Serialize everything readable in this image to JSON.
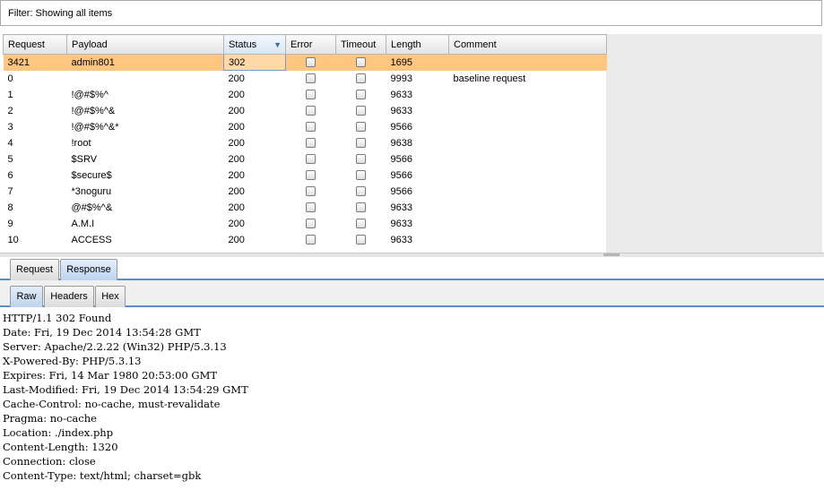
{
  "filter": {
    "text": "Filter: Showing all items"
  },
  "table": {
    "columns": [
      {
        "key": "request",
        "label": "Request"
      },
      {
        "key": "payload",
        "label": "Payload"
      },
      {
        "key": "status",
        "label": "Status",
        "sorted": "desc"
      },
      {
        "key": "error",
        "label": "Error"
      },
      {
        "key": "timeout",
        "label": "Timeout"
      },
      {
        "key": "length",
        "label": "Length"
      },
      {
        "key": "comment",
        "label": "Comment"
      }
    ],
    "rows": [
      {
        "request": "3421",
        "payload": "admin801",
        "status": "302",
        "error": false,
        "timeout": false,
        "length": "1695",
        "comment": "",
        "selected": true
      },
      {
        "request": "0",
        "payload": "",
        "status": "200",
        "error": false,
        "timeout": false,
        "length": "9993",
        "comment": "baseline request"
      },
      {
        "request": "1",
        "payload": "!@#$%^",
        "status": "200",
        "error": false,
        "timeout": false,
        "length": "9633",
        "comment": ""
      },
      {
        "request": "2",
        "payload": "!@#$%^&",
        "status": "200",
        "error": false,
        "timeout": false,
        "length": "9633",
        "comment": ""
      },
      {
        "request": "3",
        "payload": "!@#$%^&*",
        "status": "200",
        "error": false,
        "timeout": false,
        "length": "9566",
        "comment": ""
      },
      {
        "request": "4",
        "payload": "!root",
        "status": "200",
        "error": false,
        "timeout": false,
        "length": "9638",
        "comment": ""
      },
      {
        "request": "5",
        "payload": "$SRV",
        "status": "200",
        "error": false,
        "timeout": false,
        "length": "9566",
        "comment": ""
      },
      {
        "request": "6",
        "payload": "$secure$",
        "status": "200",
        "error": false,
        "timeout": false,
        "length": "9566",
        "comment": ""
      },
      {
        "request": "7",
        "payload": "*3noguru",
        "status": "200",
        "error": false,
        "timeout": false,
        "length": "9566",
        "comment": ""
      },
      {
        "request": "8",
        "payload": "@#$%^&",
        "status": "200",
        "error": false,
        "timeout": false,
        "length": "9633",
        "comment": ""
      },
      {
        "request": "9",
        "payload": "A.M.I",
        "status": "200",
        "error": false,
        "timeout": false,
        "length": "9633",
        "comment": ""
      },
      {
        "request": "10",
        "payload": "ACCESS",
        "status": "200",
        "error": false,
        "timeout": false,
        "length": "9633",
        "comment": ""
      }
    ]
  },
  "tabs": [
    {
      "label": "Request",
      "active": false
    },
    {
      "label": "Response",
      "active": true
    }
  ],
  "subtabs": [
    {
      "label": "Raw",
      "active": true
    },
    {
      "label": "Headers",
      "active": false
    },
    {
      "label": "Hex",
      "active": false
    }
  ],
  "response_lines": [
    "HTTP/1.1 302 Found",
    "Date: Fri, 19 Dec 2014 13:54:28 GMT",
    "Server: Apache/2.2.22 (Win32) PHP/5.3.13",
    "X-Powered-By: PHP/5.3.13",
    "Expires: Fri, 14 Mar 1980 20:53:00 GMT",
    "Last-Modified: Fri, 19 Dec 2014 13:54:29 GMT",
    "Cache-Control: no-cache, must-revalidate",
    "Pragma: no-cache",
    "Location: ./index.php",
    "Content-Length: 1320",
    "Connection: close",
    "Content-Type: text/html; charset=gbk"
  ],
  "colors": {
    "selected_row": "#ffc680",
    "tab_accent": "#5d8cc9",
    "sort_arrow": "#3a6ea5"
  },
  "icons": {
    "sort": "sort-descending-icon"
  }
}
